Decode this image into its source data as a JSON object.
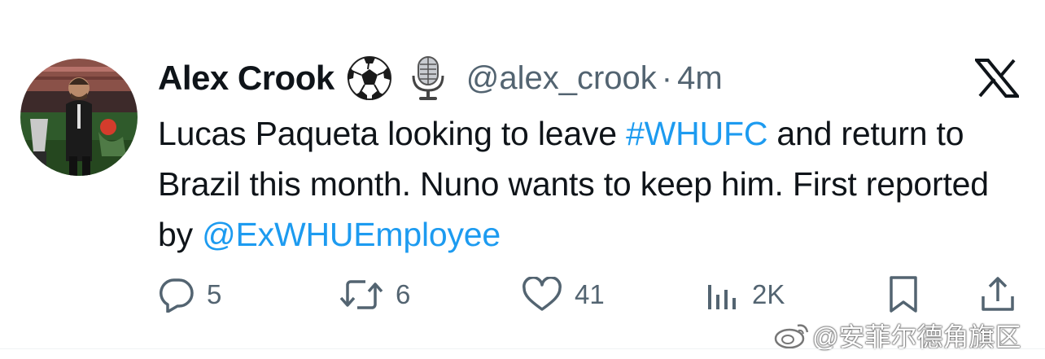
{
  "author": {
    "name": "Alex Crook",
    "handle": "@alex_crook",
    "separator": "·",
    "time": "4m",
    "emojis": [
      "soccer-ball-icon",
      "microphone-icon"
    ]
  },
  "tweet": {
    "text_1": "Lucas Paqueta looking to leave ",
    "hashtag": "#WHUFC",
    "text_2": " and return to Brazil this month. Nuno wants to keep him. First reported by ",
    "mention": "@ExWHUEmployee"
  },
  "actions": {
    "replies": "5",
    "retweets": "6",
    "likes": "41",
    "views": "2K"
  },
  "watermark": {
    "text": "@安菲尔德角旗区"
  },
  "colors": {
    "link": "#1d9bf0",
    "secondary": "#536471",
    "primary": "#0f1419"
  }
}
